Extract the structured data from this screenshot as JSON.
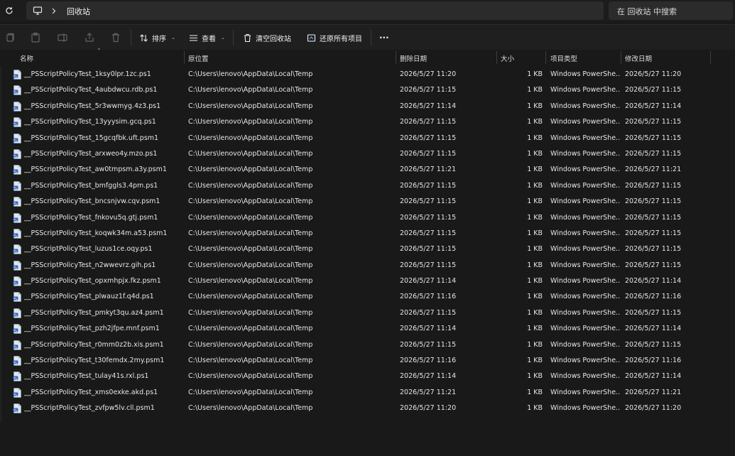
{
  "address": {
    "location": "回收站",
    "search_placeholder": "在 回收站 中搜索"
  },
  "toolbar": {
    "sort_label": "排序",
    "view_label": "查看",
    "empty_label": "清空回收站",
    "restore_all_label": "还原所有项目",
    "more_label": "···"
  },
  "columns": {
    "name": "名称",
    "location": "原位置",
    "deleted": "删除日期",
    "size": "大小",
    "type": "项目类型",
    "modified": "修改日期"
  },
  "rows": [
    {
      "name": "__PSScriptPolicyTest_1ksy0lpr.1zc.ps1",
      "location": "C:\\Users\\lenovo\\AppData\\Local\\Temp",
      "deleted": "2026/5/27 11:20",
      "size": "1 KB",
      "type": "Windows PowerShe...",
      "modified": "2026/5/27 11:20"
    },
    {
      "name": "__PSScriptPolicyTest_4aubdwcu.rdb.ps1",
      "location": "C:\\Users\\lenovo\\AppData\\Local\\Temp",
      "deleted": "2026/5/27 11:15",
      "size": "1 KB",
      "type": "Windows PowerShe...",
      "modified": "2026/5/27 11:15"
    },
    {
      "name": "__PSScriptPolicyTest_5r3wwmyg.4z3.ps1",
      "location": "C:\\Users\\lenovo\\AppData\\Local\\Temp",
      "deleted": "2026/5/27 11:14",
      "size": "1 KB",
      "type": "Windows PowerShe...",
      "modified": "2026/5/27 11:14"
    },
    {
      "name": "__PSScriptPolicyTest_13yyysim.gcq.ps1",
      "location": "C:\\Users\\lenovo\\AppData\\Local\\Temp",
      "deleted": "2026/5/27 11:15",
      "size": "1 KB",
      "type": "Windows PowerShe...",
      "modified": "2026/5/27 11:15"
    },
    {
      "name": "__PSScriptPolicyTest_15gcqfbk.uft.psm1",
      "location": "C:\\Users\\lenovo\\AppData\\Local\\Temp",
      "deleted": "2026/5/27 11:15",
      "size": "1 KB",
      "type": "Windows PowerShe...",
      "modified": "2026/5/27 11:15"
    },
    {
      "name": "__PSScriptPolicyTest_arxweo4y.mzo.ps1",
      "location": "C:\\Users\\lenovo\\AppData\\Local\\Temp",
      "deleted": "2026/5/27 11:15",
      "size": "1 KB",
      "type": "Windows PowerShe...",
      "modified": "2026/5/27 11:15"
    },
    {
      "name": "__PSScriptPolicyTest_aw0tmpsm.a3y.psm1",
      "location": "C:\\Users\\lenovo\\AppData\\Local\\Temp",
      "deleted": "2026/5/27 11:21",
      "size": "1 KB",
      "type": "Windows PowerShe...",
      "modified": "2026/5/27 11:21"
    },
    {
      "name": "__PSScriptPolicyTest_bmfggls3.4pm.ps1",
      "location": "C:\\Users\\lenovo\\AppData\\Local\\Temp",
      "deleted": "2026/5/27 11:15",
      "size": "1 KB",
      "type": "Windows PowerShe...",
      "modified": "2026/5/27 11:15"
    },
    {
      "name": "__PSScriptPolicyTest_bncsnjvw.cqv.psm1",
      "location": "C:\\Users\\lenovo\\AppData\\Local\\Temp",
      "deleted": "2026/5/27 11:15",
      "size": "1 KB",
      "type": "Windows PowerShe...",
      "modified": "2026/5/27 11:15"
    },
    {
      "name": "__PSScriptPolicyTest_fnkovu5q.gtj.psm1",
      "location": "C:\\Users\\lenovo\\AppData\\Local\\Temp",
      "deleted": "2026/5/27 11:15",
      "size": "1 KB",
      "type": "Windows PowerShe...",
      "modified": "2026/5/27 11:15"
    },
    {
      "name": "__PSScriptPolicyTest_koqwk34m.a53.psm1",
      "location": "C:\\Users\\lenovo\\AppData\\Local\\Temp",
      "deleted": "2026/5/27 11:15",
      "size": "1 KB",
      "type": "Windows PowerShe...",
      "modified": "2026/5/27 11:15"
    },
    {
      "name": "__PSScriptPolicyTest_luzus1ce.oqy.ps1",
      "location": "C:\\Users\\lenovo\\AppData\\Local\\Temp",
      "deleted": "2026/5/27 11:15",
      "size": "1 KB",
      "type": "Windows PowerShe...",
      "modified": "2026/5/27 11:15"
    },
    {
      "name": "__PSScriptPolicyTest_n2wwevrz.gih.ps1",
      "location": "C:\\Users\\lenovo\\AppData\\Local\\Temp",
      "deleted": "2026/5/27 11:15",
      "size": "1 KB",
      "type": "Windows PowerShe...",
      "modified": "2026/5/27 11:15"
    },
    {
      "name": "__PSScriptPolicyTest_opxmhpjx.fkz.psm1",
      "location": "C:\\Users\\lenovo\\AppData\\Local\\Temp",
      "deleted": "2026/5/27 11:14",
      "size": "1 KB",
      "type": "Windows PowerShe...",
      "modified": "2026/5/27 11:14"
    },
    {
      "name": "__PSScriptPolicyTest_plwauz1f.q4d.ps1",
      "location": "C:\\Users\\lenovo\\AppData\\Local\\Temp",
      "deleted": "2026/5/27 11:16",
      "size": "1 KB",
      "type": "Windows PowerShe...",
      "modified": "2026/5/27 11:16"
    },
    {
      "name": "__PSScriptPolicyTest_pmkyt3qu.az4.psm1",
      "location": "C:\\Users\\lenovo\\AppData\\Local\\Temp",
      "deleted": "2026/5/27 11:15",
      "size": "1 KB",
      "type": "Windows PowerShe...",
      "modified": "2026/5/27 11:15"
    },
    {
      "name": "__PSScriptPolicyTest_pzh2jfpe.mnf.psm1",
      "location": "C:\\Users\\lenovo\\AppData\\Local\\Temp",
      "deleted": "2026/5/27 11:14",
      "size": "1 KB",
      "type": "Windows PowerShe...",
      "modified": "2026/5/27 11:14"
    },
    {
      "name": "__PSScriptPolicyTest_r0mm0z2b.xis.psm1",
      "location": "C:\\Users\\lenovo\\AppData\\Local\\Temp",
      "deleted": "2026/5/27 11:15",
      "size": "1 KB",
      "type": "Windows PowerShe...",
      "modified": "2026/5/27 11:15"
    },
    {
      "name": "__PSScriptPolicyTest_t30femdx.2my.psm1",
      "location": "C:\\Users\\lenovo\\AppData\\Local\\Temp",
      "deleted": "2026/5/27 11:16",
      "size": "1 KB",
      "type": "Windows PowerShe...",
      "modified": "2026/5/27 11:16"
    },
    {
      "name": "__PSScriptPolicyTest_tulay41s.rxl.ps1",
      "location": "C:\\Users\\lenovo\\AppData\\Local\\Temp",
      "deleted": "2026/5/27 11:14",
      "size": "1 KB",
      "type": "Windows PowerShe...",
      "modified": "2026/5/27 11:14"
    },
    {
      "name": "__PSScriptPolicyTest_xms0exke.akd.ps1",
      "location": "C:\\Users\\lenovo\\AppData\\Local\\Temp",
      "deleted": "2026/5/27 11:21",
      "size": "1 KB",
      "type": "Windows PowerShe...",
      "modified": "2026/5/27 11:21"
    },
    {
      "name": "__PSScriptPolicyTest_zvfpw5lv.cll.psm1",
      "location": "C:\\Users\\lenovo\\AppData\\Local\\Temp",
      "deleted": "2026/5/27 11:20",
      "size": "1 KB",
      "type": "Windows PowerShe...",
      "modified": "2026/5/27 11:20"
    }
  ]
}
